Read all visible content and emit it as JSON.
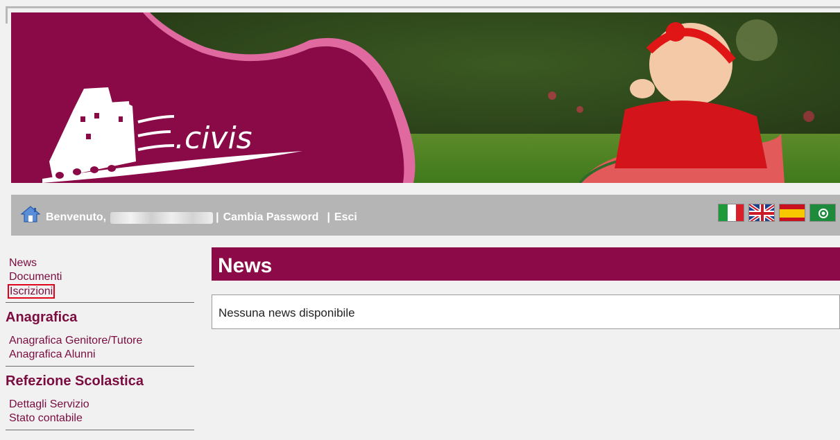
{
  "banner": {
    "logo_text": "E.civis"
  },
  "toolbar": {
    "welcome_label": "Benvenuto,",
    "change_password": "Cambia Password",
    "separator_1": "|",
    "separator_2": "|",
    "logout": "Esci",
    "flags": [
      "italian-flag-icon",
      "uk-flag-icon",
      "spanish-flag-icon",
      "arabic-flag-icon"
    ]
  },
  "sidebar": {
    "top_links": [
      "News",
      "Documenti",
      "Iscrizioni"
    ],
    "sections": [
      {
        "title": "Anagrafica",
        "links": [
          "Anagrafica Genitore/Tutore",
          "Anagrafica Alunni"
        ]
      },
      {
        "title": "Refezione Scolastica",
        "links": [
          "Dettagli Servizio",
          "Stato contabile"
        ]
      }
    ]
  },
  "main": {
    "title": "News",
    "empty_message": "Nessuna news disponibile"
  },
  "colors": {
    "brand": "#8c0a47",
    "toolbar": "#b5b5b5",
    "highlight_box": "#e1001a"
  }
}
